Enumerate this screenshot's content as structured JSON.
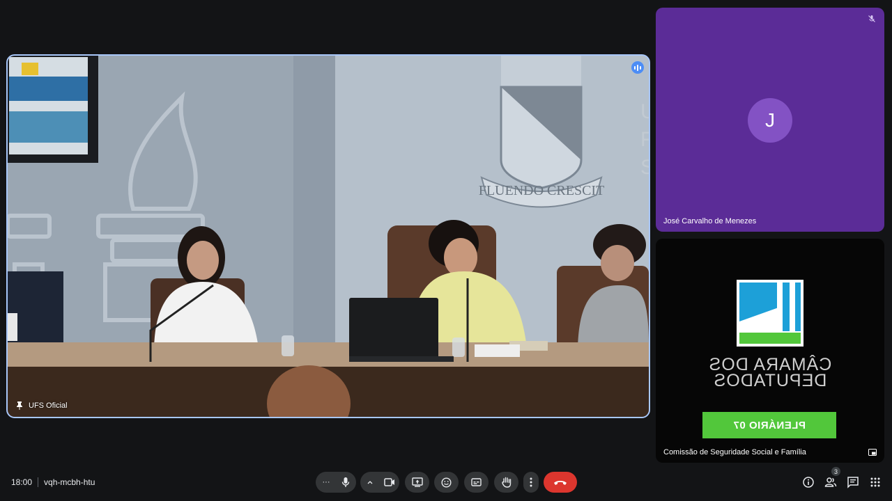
{
  "main_tile": {
    "participant_name": "UFS Oficial",
    "crest_motto": "FLUENDO CRESCIT",
    "wall_letters": [
      "U",
      "F",
      "S"
    ]
  },
  "side_tiles": [
    {
      "participant_name": "José Carvalho de Menezes",
      "avatar_initial": "J",
      "muted": true,
      "bg_color": "#5b2c97"
    },
    {
      "participant_name": "Comissão de Seguridade Social e Família",
      "logo_text_line1": "CÂMARA DOS",
      "logo_text_line2": "DEPUTADOS",
      "sign_text": "PLENÁRIO 07"
    }
  ],
  "meeting": {
    "time": "18:00",
    "code": "vqh-mcbh-htu"
  },
  "controls": {
    "more_options_label": "···",
    "participants_count": "3"
  },
  "colors": {
    "end_call": "#dc362e",
    "active_border": "#a8c7fa",
    "plenario_green": "#52c73b"
  }
}
